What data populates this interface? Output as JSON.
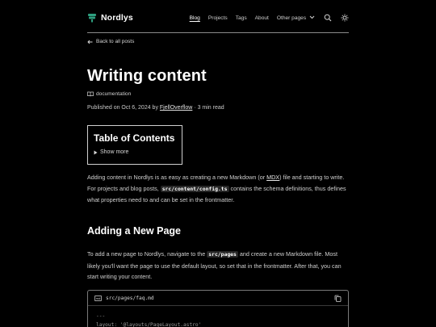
{
  "header": {
    "brand": "Nordlys",
    "nav": [
      {
        "label": "Blog",
        "active": true
      },
      {
        "label": "Projects"
      },
      {
        "label": "Tags"
      },
      {
        "label": "About"
      },
      {
        "label": "Other pages"
      }
    ]
  },
  "back_link": "Back to all posts",
  "post": {
    "title": "Writing content",
    "tag": "documentation",
    "published_prefix": "Published on Oct 6, 2024 by ",
    "author": "FjellOverflow",
    "read_time": " · 3 min read"
  },
  "toc": {
    "title": "Table of Contents",
    "toggle": "Show more"
  },
  "intro": {
    "t1": "Adding content in Nordlys is as easy as creating a new Markdown (or ",
    "mdx": "MDX",
    "t2": ") file and starting to write. For projects and blog posts, ",
    "code": "src/content/config.ts",
    "t3": " contains the schema definitions, thus defines what properties need to and can be set in the frontmatter."
  },
  "section1": {
    "heading": "Adding a New Page",
    "t1": "To add a new page to Nordlys, navigate to the ",
    "code": "src/pages",
    "t2": " and create a new Markdown file. Most likely you'll want the page to use the default layout, so set that in the frontmatter. After that, you can start writing your content."
  },
  "codeblock": {
    "lang_badge": "md",
    "filename": "src/pages/faq.md",
    "lines": [
      "---",
      "layout: '@layouts/PageLayout.astro'"
    ]
  },
  "colors": {
    "background": "#000000",
    "text": "#e6e6e6",
    "accent": "#2e9e7e"
  }
}
